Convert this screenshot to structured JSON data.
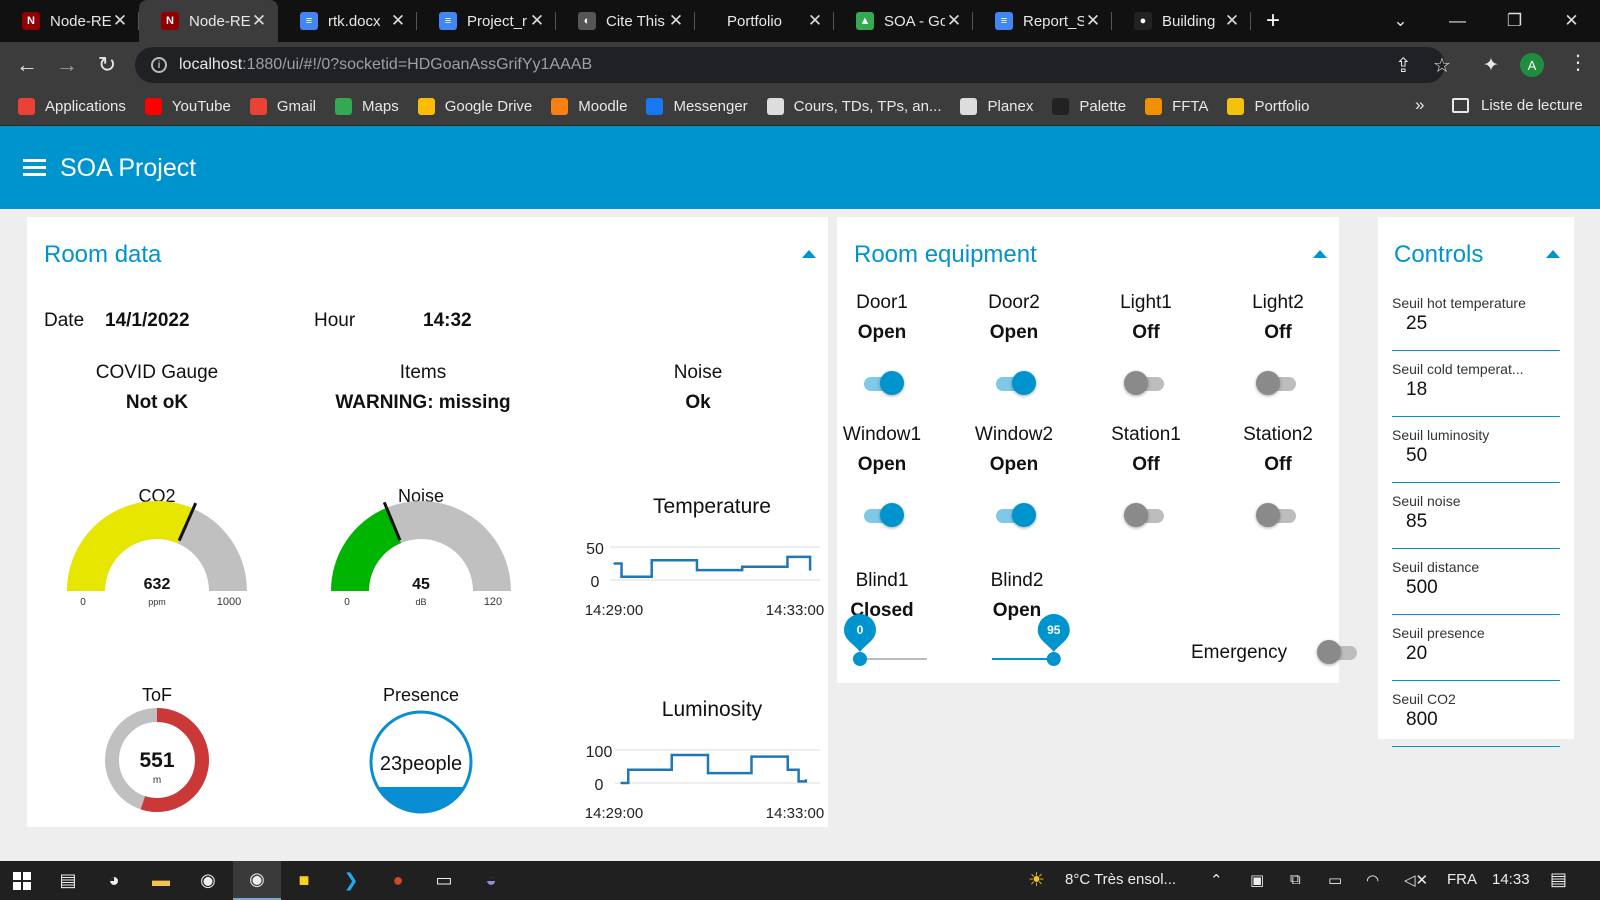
{
  "browser": {
    "tabs": [
      {
        "title": "Node-RE",
        "active": false,
        "color": "#8f0000",
        "glyph": "N"
      },
      {
        "title": "Node-RE",
        "active": true,
        "color": "#8f0000",
        "glyph": "N"
      },
      {
        "title": "rtk.docx",
        "active": false,
        "color": "#4285f4",
        "glyph": "≡"
      },
      {
        "title": "Project_r",
        "active": false,
        "color": "#4285f4",
        "glyph": "≡"
      },
      {
        "title": "Cite This",
        "active": false,
        "color": "#555555",
        "glyph": "◐"
      },
      {
        "title": "Portfolio",
        "active": false,
        "color": "",
        "glyph": ""
      },
      {
        "title": "SOA - Go",
        "active": false,
        "color": "#34a853",
        "glyph": "▲"
      },
      {
        "title": "Report_S",
        "active": false,
        "color": "#4285f4",
        "glyph": "≡"
      },
      {
        "title": "Building",
        "active": false,
        "color": "#222222",
        "glyph": "●"
      }
    ],
    "url_host": "localhost",
    "url_rest": ":1880/ui/#!/0?socketid=HDGoanAssGrifYy1AAAB",
    "profile_initial": "A",
    "bookmarks": [
      {
        "label": "Applications",
        "color": "#e94235"
      },
      {
        "label": "YouTube",
        "color": "#ff0000"
      },
      {
        "label": "Gmail",
        "color": "#ea4335"
      },
      {
        "label": "Maps",
        "color": "#34a853"
      },
      {
        "label": "Google Drive",
        "color": "#fbbc04"
      },
      {
        "label": "Moodle",
        "color": "#f98012"
      },
      {
        "label": "Messenger",
        "color": "#1877f2"
      },
      {
        "label": "Cours, TDs, TPs, an...",
        "color": "#dddddd"
      },
      {
        "label": "Planex",
        "color": "#dddddd"
      },
      {
        "label": "Palette",
        "color": "#222222"
      },
      {
        "label": "FFTA",
        "color": "#f29100"
      },
      {
        "label": "Portfolio",
        "color": "#f4c20d"
      }
    ],
    "more": "»",
    "reading_list": "Liste de lecture"
  },
  "app": {
    "title": "SOA Project",
    "accent": "#0094ce"
  },
  "room_data": {
    "title": "Room data",
    "date_label": "Date",
    "date_value": "14/1/2022",
    "hour_label": "Hour",
    "hour_value": "14:32",
    "covid_label": "COVID Gauge",
    "covid_value": "Not oK",
    "items_label": "Items",
    "items_value": "WARNING: missing",
    "noise_label": "Noise",
    "noise_value": "Ok",
    "co2_gauge": {
      "label": "CO2",
      "value": "632",
      "unit": "ppm",
      "min": "0",
      "max": "1000",
      "fraction": 0.632,
      "color": "#e6e600"
    },
    "noise_gauge": {
      "label": "Noise",
      "value": "45",
      "unit": "dB",
      "min": "0",
      "max": "120",
      "fraction": 0.375,
      "color": "#00b500"
    },
    "tof_gauge": {
      "label": "ToF",
      "value": "551",
      "unit": "m",
      "fraction": 0.55,
      "color": "#ca3838"
    },
    "presence": {
      "label": "Presence",
      "value": "23people",
      "level": 0.25
    }
  },
  "chart_data": [
    {
      "type": "line",
      "title": "Temperature",
      "ylim": [
        0,
        50
      ],
      "yticks": [
        "50",
        "0"
      ],
      "xticks": [
        "14:29:00",
        "14:33:00"
      ],
      "x": [
        "14:29:00",
        "14:29:10",
        "14:29:30",
        "14:29:50",
        "14:30:30",
        "14:30:50",
        "14:31:30",
        "14:31:50",
        "14:32:30",
        "14:32:50",
        "14:33:10",
        "14:33:20"
      ],
      "values": [
        25,
        5,
        5,
        30,
        30,
        15,
        15,
        20,
        20,
        35,
        35,
        15
      ],
      "color": "#1f77b4"
    },
    {
      "type": "line",
      "title": "Luminosity",
      "ylim": [
        0,
        100
      ],
      "yticks": [
        "100",
        "0"
      ],
      "xticks": [
        "14:29:00",
        "14:33:00"
      ],
      "x": [
        "14:29:00",
        "14:29:10",
        "14:29:50",
        "14:30:10",
        "14:30:40",
        "14:31:00",
        "14:31:40",
        "14:32:00",
        "14:32:30",
        "14:32:50",
        "14:33:05",
        "14:33:15"
      ],
      "values": [
        0,
        40,
        40,
        85,
        85,
        30,
        30,
        80,
        80,
        40,
        5,
        10
      ],
      "color": "#1f77b4"
    }
  ],
  "equipment": {
    "title": "Room equipment",
    "devices": [
      {
        "name": "Door1",
        "state": "Open",
        "on": true
      },
      {
        "name": "Door2",
        "state": "Open",
        "on": true
      },
      {
        "name": "Light1",
        "state": "Off",
        "on": false
      },
      {
        "name": "Light2",
        "state": "Off",
        "on": false
      },
      {
        "name": "Window1",
        "state": "Open",
        "on": true
      },
      {
        "name": "Window2",
        "state": "Open",
        "on": true
      },
      {
        "name": "Station1",
        "state": "Off",
        "on": false
      },
      {
        "name": "Station2",
        "state": "Off",
        "on": false
      }
    ],
    "blinds": [
      {
        "name": "Blind1",
        "state": "Closed",
        "value": "0",
        "fraction": 0
      },
      {
        "name": "Blind2",
        "state": "Open",
        "value": "95",
        "fraction": 0.95
      }
    ],
    "emergency_label": "Emergency",
    "emergency_on": false
  },
  "controls": {
    "title": "Controls",
    "fields": [
      {
        "label": "Seuil hot temperature",
        "value": "25"
      },
      {
        "label": "Seuil cold temperat...",
        "value": "18"
      },
      {
        "label": "Seuil luminosity",
        "value": "50"
      },
      {
        "label": "Seuil noise",
        "value": "85"
      },
      {
        "label": "Seuil distance",
        "value": "500"
      },
      {
        "label": "Seuil presence",
        "value": "20"
      },
      {
        "label": "Seuil CO2",
        "value": "800"
      }
    ]
  },
  "taskbar": {
    "weather": "8°C  Très ensol...",
    "lang": "FRA",
    "time": "14:33"
  }
}
